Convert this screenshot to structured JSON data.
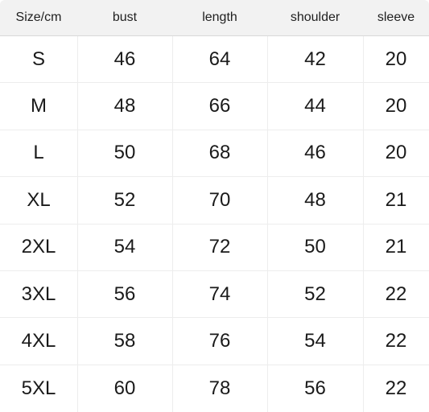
{
  "table": {
    "columns": [
      "Size/cm",
      "bust",
      "length",
      "shoulder",
      "sleeve"
    ],
    "rows": [
      {
        "size": "S",
        "bust": "46",
        "length": "64",
        "shoulder": "42",
        "sleeve": "20"
      },
      {
        "size": "M",
        "bust": "48",
        "length": "66",
        "shoulder": "44",
        "sleeve": "20"
      },
      {
        "size": "L",
        "bust": "50",
        "length": "68",
        "shoulder": "46",
        "sleeve": "20"
      },
      {
        "size": "XL",
        "bust": "52",
        "length": "70",
        "shoulder": "48",
        "sleeve": "21"
      },
      {
        "size": "2XL",
        "bust": "54",
        "length": "72",
        "shoulder": "50",
        "sleeve": "21"
      },
      {
        "size": "3XL",
        "bust": "56",
        "length": "74",
        "shoulder": "52",
        "sleeve": "22"
      },
      {
        "size": "4XL",
        "bust": "58",
        "length": "76",
        "shoulder": "54",
        "sleeve": "22"
      },
      {
        "size": "5XL",
        "bust": "60",
        "length": "78",
        "shoulder": "56",
        "sleeve": "22"
      }
    ]
  },
  "colors": {
    "header_background": "#f2f2f2",
    "header_border": "#d9d9d9",
    "grid_line": "#ededed",
    "text": "#1a1a1a",
    "page_background": "#ffffff"
  }
}
